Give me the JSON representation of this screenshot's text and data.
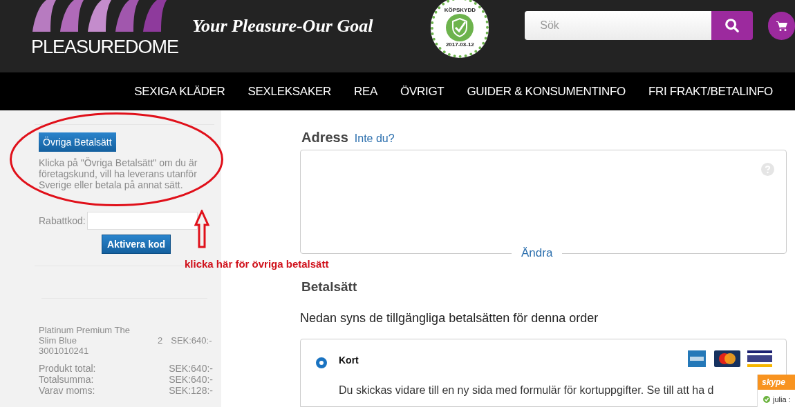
{
  "header": {
    "logo_text": "PLEASUREDOME",
    "tagline": "Your Pleasure-Our Goal",
    "badge": {
      "top_text": "KÖPSKYDD",
      "date": "2017-03-12"
    },
    "search": {
      "placeholder": "Sök"
    }
  },
  "nav": [
    "SEXIGA KLÄDER",
    "SEXLEKSAKER",
    "REA",
    "ÖVRIGT",
    "GUIDER & KONSUMENTINFO",
    "FRI FRAKT/BETALINFO"
  ],
  "sidebar": {
    "other_payment_button": "Övriga Betalsätt",
    "note": "Klicka på \"Övriga Betalsätt\" om du är företagskund, vill ha leverans utanför Sverige eller betala på annat sätt.",
    "discount": {
      "label": "Rabattkod:",
      "button": "Aktivera kod"
    },
    "items": [
      {
        "name": "Platinum Premium The Slim Blue",
        "sku": "3001010241",
        "qty": "2",
        "price": "SEK:640:-"
      }
    ],
    "totals": [
      {
        "label": "Produkt total:",
        "value": "SEK:640:-"
      },
      {
        "label": "Totalsumma:",
        "value": "SEK:640:-"
      },
      {
        "label": "Varav moms:",
        "value": "SEK:128:-"
      }
    ]
  },
  "annotation": {
    "text": "klicka här för övriga betalsätt"
  },
  "address": {
    "title": "Adress",
    "link": "Inte du?",
    "change_link": "Ändra"
  },
  "payment": {
    "title": "Betalsätt",
    "intro": "Nedan syns de tillgängliga betalsätten för denna order",
    "options": [
      {
        "label": "Kort",
        "selected": true,
        "description": "Du skickas vidare till en ny sida med formulär för kortuppgifter. Se till att ha d"
      }
    ]
  },
  "chat_widget": {
    "title": "skype",
    "contact": "julia :"
  }
}
